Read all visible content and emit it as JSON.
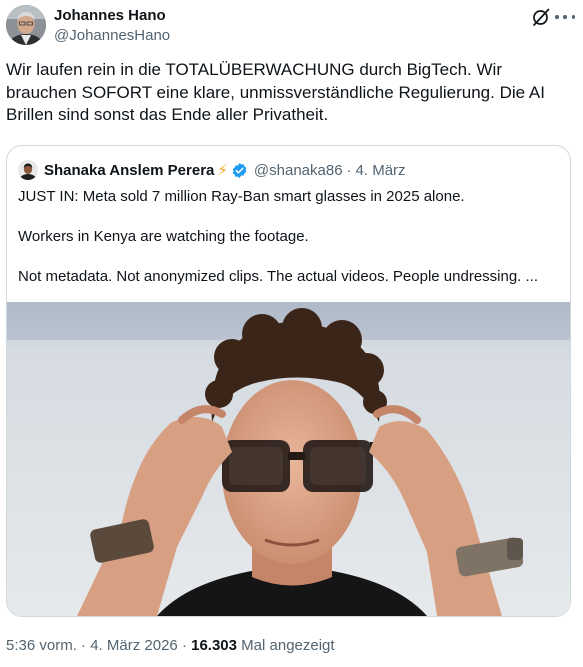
{
  "tweet": {
    "author": {
      "name": "Johannes Hano",
      "handle": "@JohannesHano"
    },
    "text": "Wir laufen rein in die TOTALÜBERWACHUNG durch BigTech. Wir brauchen SOFORT eine klare, unmissverständliche Regulierung. Die AI Brillen sind sonst das Ende aller Privatheit.",
    "meta": {
      "time": "5:36 vorm.",
      "separator": "·",
      "date": "4. März 2026",
      "views_count": "16.303",
      "views_label": "Mal angezeigt"
    }
  },
  "quote": {
    "name": "Shanaka Anslem Perera",
    "emoji": "⚡",
    "handle": "@shanaka86",
    "separator": "·",
    "date": "4. März",
    "line1": "JUST IN: Meta sold 7 million Ray-Ban smart glasses in 2025 alone.",
    "line2": "Workers in Kenya are watching the footage.",
    "line3": "Not metadata. Not anonymized clips. The actual videos. People undressing. ..."
  },
  "icons": {
    "grok": "grok-icon",
    "more": "more-icon",
    "verified": "verified-badge-icon"
  },
  "colors": {
    "text_primary": "#0f1419",
    "text_secondary": "#536471",
    "border": "#cfd9de",
    "verified_blue": "#1d9bf0"
  }
}
